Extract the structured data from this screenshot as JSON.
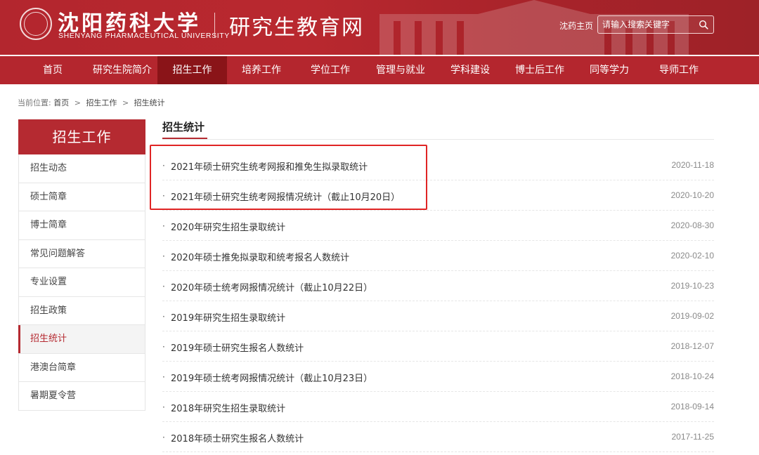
{
  "header": {
    "logo_cn": "沈阳药科大学",
    "logo_en": "SHENYANG PHARMACEUTICAL UNIVERSITY",
    "site_title": "研究生教育网",
    "home_link": "沈药主页",
    "search_placeholder": "请输入搜索关键字",
    "search_icon": "search-icon",
    "brand_color": "#b4262e"
  },
  "nav": {
    "items": [
      {
        "label": "首页"
      },
      {
        "label": "研究生院简介"
      },
      {
        "label": "招生工作"
      },
      {
        "label": "培养工作"
      },
      {
        "label": "学位工作"
      },
      {
        "label": "管理与就业"
      },
      {
        "label": "学科建设"
      },
      {
        "label": "博士后工作"
      },
      {
        "label": "同等学力"
      },
      {
        "label": "导师工作"
      }
    ],
    "active": "招生工作"
  },
  "breadcrumb": {
    "prefix": "当前位置:",
    "items": [
      "首页",
      "招生工作",
      "招生统计"
    ],
    "separator": ">"
  },
  "sidebar": {
    "title": "招生工作",
    "items": [
      {
        "label": "招生动态"
      },
      {
        "label": "硕士简章"
      },
      {
        "label": "博士简章"
      },
      {
        "label": "常见问题解答"
      },
      {
        "label": "专业设置"
      },
      {
        "label": "招生政策"
      },
      {
        "label": "招生统计"
      },
      {
        "label": "港澳台简章"
      },
      {
        "label": "暑期夏令营"
      }
    ],
    "active": "招生统计"
  },
  "main": {
    "title": "招生统计",
    "articles": [
      {
        "title": "2021年硕士研究生统考网报和推免生拟录取统计",
        "date": "2020-11-18"
      },
      {
        "title": "2021年硕士研究生统考网报情况统计（截止10月20日）",
        "date": "2020-10-20"
      },
      {
        "title": "2020年研究生招生录取统计",
        "date": "2020-08-30"
      },
      {
        "title": "2020年硕士推免拟录取和统考报名人数统计",
        "date": "2020-02-10"
      },
      {
        "title": "2020年硕士统考网报情况统计（截止10月22日）",
        "date": "2019-10-23"
      },
      {
        "title": "2019年研究生招生录取统计",
        "date": "2019-09-02"
      },
      {
        "title": "2019年硕士研究生报名人数统计",
        "date": "2018-12-07"
      },
      {
        "title": "2019年硕士统考网报情况统计（截止10月23日）",
        "date": "2018-10-24"
      },
      {
        "title": "2018年研究生招生录取统计",
        "date": "2018-09-14"
      },
      {
        "title": "2018年硕士研究生报名人数统计",
        "date": "2017-11-25"
      }
    ],
    "bullet": "·",
    "highlight_color": "#e02424"
  }
}
